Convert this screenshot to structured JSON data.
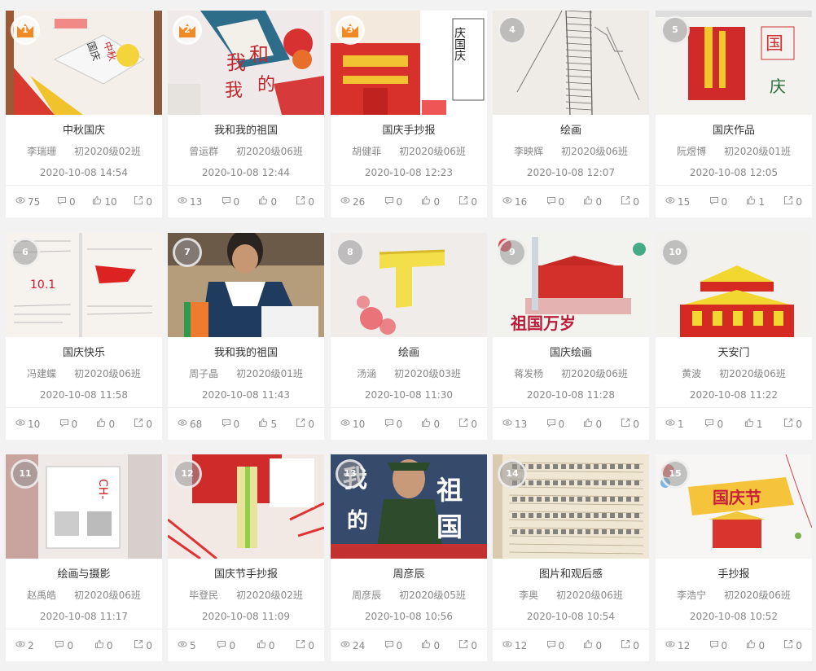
{
  "cards": [
    {
      "rank": "1",
      "title": "中秋国庆",
      "author": "李瑞珊",
      "klass": "初2020级02班",
      "date": "2020-10-08 14:54",
      "views": "75",
      "comments": "0",
      "likes": "10",
      "shares": "0",
      "thumb": "thumb-art-1"
    },
    {
      "rank": "2",
      "title": "我和我的祖国",
      "author": "曾运群",
      "klass": "初2020级06班",
      "date": "2020-10-08 12:44",
      "views": "13",
      "comments": "0",
      "likes": "0",
      "shares": "0",
      "thumb": "thumb-art-2"
    },
    {
      "rank": "3",
      "title": "国庆手抄报",
      "author": "胡健菲",
      "klass": "初2020级06班",
      "date": "2020-10-08 12:23",
      "views": "26",
      "comments": "0",
      "likes": "0",
      "shares": "0",
      "thumb": "thumb-art-3"
    },
    {
      "rank": "4",
      "title": "绘画",
      "author": "李映辉",
      "klass": "初2020级06班",
      "date": "2020-10-08 12:07",
      "views": "16",
      "comments": "0",
      "likes": "0",
      "shares": "0",
      "thumb": "thumb-art-4"
    },
    {
      "rank": "5",
      "title": "国庆作品",
      "author": "阮煜博",
      "klass": "初2020级01班",
      "date": "2020-10-08 12:05",
      "views": "15",
      "comments": "0",
      "likes": "1",
      "shares": "0",
      "thumb": "thumb-art-5"
    },
    {
      "rank": "6",
      "title": "国庆快乐",
      "author": "冯建蝶",
      "klass": "初2020级06班",
      "date": "2020-10-08 11:58",
      "views": "10",
      "comments": "0",
      "likes": "0",
      "shares": "0",
      "thumb": "thumb-art-6"
    },
    {
      "rank": "7",
      "title": "我和我的祖国",
      "author": "周子晶",
      "klass": "初2020级01班",
      "date": "2020-10-08 11:43",
      "views": "68",
      "comments": "0",
      "likes": "5",
      "shares": "0",
      "thumb": "thumb-photo-7"
    },
    {
      "rank": "8",
      "title": "绘画",
      "author": "汤涵",
      "klass": "初2020级03班",
      "date": "2020-10-08 11:30",
      "views": "10",
      "comments": "0",
      "likes": "0",
      "shares": "0",
      "thumb": "thumb-art-8"
    },
    {
      "rank": "9",
      "title": "国庆绘画",
      "author": "蒋发杨",
      "klass": "初2020级06班",
      "date": "2020-10-08 11:28",
      "views": "13",
      "comments": "0",
      "likes": "0",
      "shares": "0",
      "thumb": "thumb-art-9"
    },
    {
      "rank": "10",
      "title": "天安门",
      "author": "黄波",
      "klass": "初2020级06班",
      "date": "2020-10-08 11:22",
      "views": "1",
      "comments": "0",
      "likes": "1",
      "shares": "0",
      "thumb": "thumb-art-10"
    },
    {
      "rank": "11",
      "title": "绘画与摄影",
      "author": "赵禹皓",
      "klass": "初2020级06班",
      "date": "2020-10-08 11:17",
      "views": "2",
      "comments": "0",
      "likes": "0",
      "shares": "0",
      "thumb": "thumb-art-11"
    },
    {
      "rank": "12",
      "title": "国庆节手抄报",
      "author": "毕登民",
      "klass": "初2020级02班",
      "date": "2020-10-08 11:09",
      "views": "5",
      "comments": "0",
      "likes": "0",
      "shares": "0",
      "thumb": "thumb-art-12"
    },
    {
      "rank": "13",
      "title": "周彦辰",
      "author": "周彦辰",
      "klass": "初2020级05班",
      "date": "2020-10-08 10:56",
      "views": "24",
      "comments": "0",
      "likes": "0",
      "shares": "0",
      "thumb": "thumb-poster-13"
    },
    {
      "rank": "14",
      "title": "图片和观后感",
      "author": "李奥",
      "klass": "初2020级06班",
      "date": "2020-10-08 10:54",
      "views": "12",
      "comments": "0",
      "likes": "0",
      "shares": "0",
      "thumb": "thumb-essay-14"
    },
    {
      "rank": "15",
      "title": "手抄报",
      "author": "李浩宁",
      "klass": "初2020级06班",
      "date": "2020-10-08 10:52",
      "views": "12",
      "comments": "0",
      "likes": "0",
      "shares": "0",
      "thumb": "thumb-art-15"
    }
  ],
  "thumbnail_text": {
    "c1": [
      "中秋",
      "国庆"
    ],
    "c2": [
      "我",
      "和",
      "我",
      "的"
    ],
    "c3": [
      "庆国庆"
    ],
    "c5": [
      "国",
      "庆"
    ],
    "c6": [
      "10.1"
    ],
    "c9": [
      "祖国万岁"
    ],
    "c11": [
      "CH-"
    ],
    "c13": [
      "我",
      "的",
      "祖",
      "国"
    ],
    "c15": [
      "国庆节"
    ]
  },
  "colors": {
    "background": "#f2f2f2",
    "card": "#ffffff",
    "muted_text": "#888888",
    "title_text": "#333333",
    "crown": "#f08a24",
    "rank_badge": "#9a9a9a"
  }
}
